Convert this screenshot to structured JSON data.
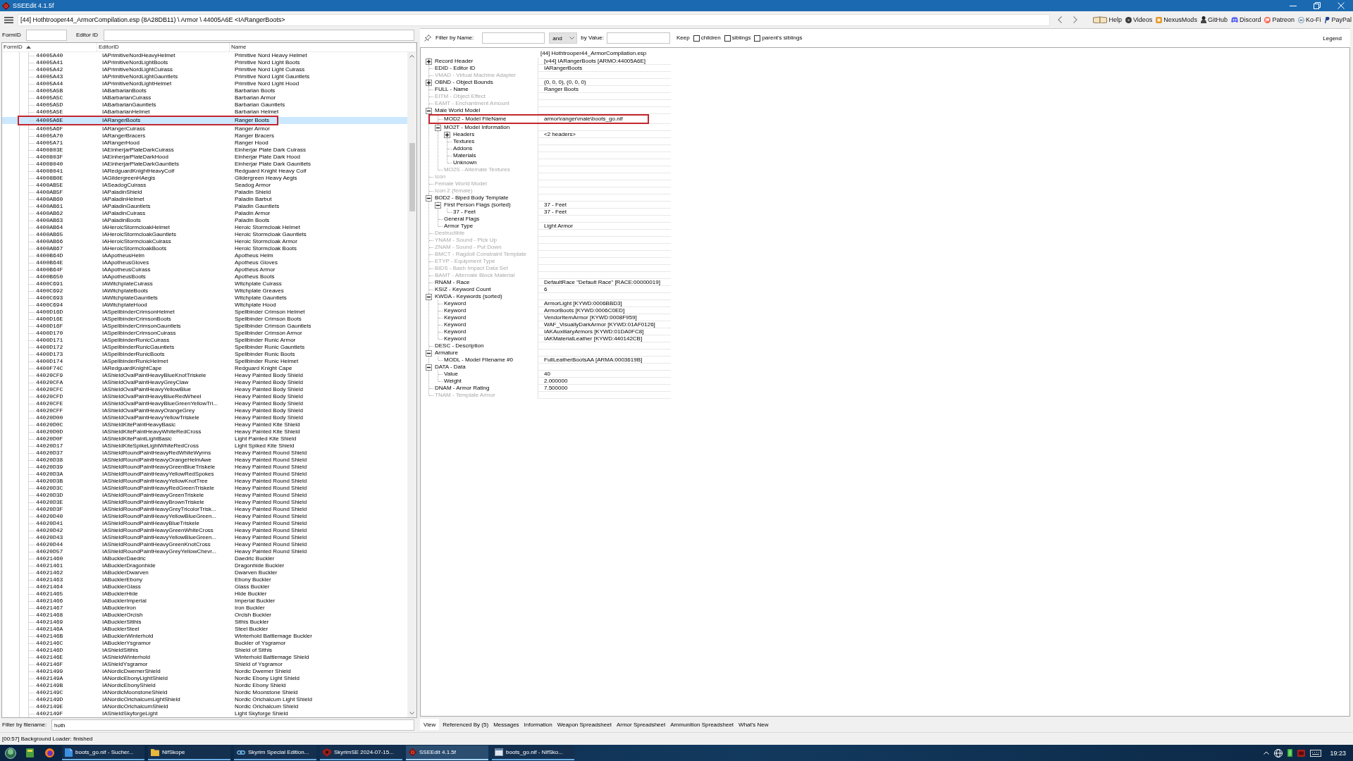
{
  "window": {
    "title": "SSEEdit 4.1.5f"
  },
  "path_bar": {
    "path": "[44] Hothtrooper44_ArmorCompilation.esp (8A28DB11) \\ Armor \\ 44005A6E <IARangerBoots>"
  },
  "toolbar_links": [
    "Help",
    "Videos",
    "NexusMods",
    "GitHub",
    "Discord",
    "Patreon",
    "Ko-Fi",
    "PayPal"
  ],
  "record_filter": {
    "formid_label": "FormID",
    "editorid_label": "Editor ID"
  },
  "record_list": {
    "columns": [
      {
        "label": "FormID",
        "sorted": true
      },
      {
        "label": "EditorID",
        "sorted": false
      },
      {
        "label": "Name",
        "sorted": false
      }
    ],
    "rows": [
      {
        "form_id": "44005A40",
        "editor_id": "IAPrimitiveNordHeavyHelmet",
        "name": "Primitive Nord Heavy Helmet",
        "selected": false,
        "marked": false
      },
      {
        "form_id": "44005A41",
        "editor_id": "IAPrimitiveNordLightBoots",
        "name": "Primitive Nord Light Boots",
        "selected": false,
        "marked": false
      },
      {
        "form_id": "44005A42",
        "editor_id": "IAPrimitiveNordLightCuirass",
        "name": "Primitive Nord Light Cuirass",
        "selected": false,
        "marked": false
      },
      {
        "form_id": "44005A43",
        "editor_id": "IAPrimitiveNordLightGauntlets",
        "name": "Primitive Nord Light Gauntlets",
        "selected": false,
        "marked": false
      },
      {
        "form_id": "44005A44",
        "editor_id": "IAPrimitiveNordLightHelmet",
        "name": "Primitive Nord Light Hood",
        "selected": false,
        "marked": false
      },
      {
        "form_id": "44005A5B",
        "editor_id": "IABarbarianBoots",
        "name": "Barbarian Boots",
        "selected": false,
        "marked": false
      },
      {
        "form_id": "44005A5C",
        "editor_id": "IABarbarianCuirass",
        "name": "Barbarian Armor",
        "selected": false,
        "marked": false
      },
      {
        "form_id": "44005A5D",
        "editor_id": "IABarbarianGauntlets",
        "name": "Barbarian Gauntlets",
        "selected": false,
        "marked": false
      },
      {
        "form_id": "44005A5E",
        "editor_id": "IABarbarianHelmet",
        "name": "Barbarian Helmet",
        "selected": false,
        "marked": false
      },
      {
        "form_id": "44005A6E",
        "editor_id": "IARangerBoots",
        "name": "Ranger Boots",
        "selected": true,
        "marked": true
      },
      {
        "form_id": "44005A6F",
        "editor_id": "IARangerCuirass",
        "name": "Ranger Armor",
        "selected": false,
        "marked": false
      },
      {
        "form_id": "44005A70",
        "editor_id": "IARangerBracers",
        "name": "Ranger Bracers",
        "selected": false,
        "marked": false
      },
      {
        "form_id": "44005A71",
        "editor_id": "IARangerHood",
        "name": "Ranger Hood",
        "selected": false,
        "marked": false
      },
      {
        "form_id": "4400803E",
        "editor_id": "IAEinherjarPlateDarkCuirass",
        "name": "Einherjar Plate Dark Cuirass",
        "selected": false,
        "marked": false
      },
      {
        "form_id": "4400803F",
        "editor_id": "IAEinherjarPlateDarkHood",
        "name": "Einherjar Plate Dark Hood",
        "selected": false,
        "marked": false
      },
      {
        "form_id": "44008040",
        "editor_id": "IAEinherjarPlateDarkGauntlets",
        "name": "Einherjar Plate Dark Gauntlets",
        "selected": false,
        "marked": false
      },
      {
        "form_id": "44008041",
        "editor_id": "IARedguardKnightHeavyCoif",
        "name": "Redguard Knight Heavy Coif",
        "selected": false,
        "marked": false
      },
      {
        "form_id": "44008B0E",
        "editor_id": "IAGildergreenHAegis",
        "name": "Gildergreen Heavy Aegis",
        "selected": false,
        "marked": false
      },
      {
        "form_id": "4400AB5E",
        "editor_id": "IASeadogCuirass",
        "name": "Seadog Armor",
        "selected": false,
        "marked": false
      },
      {
        "form_id": "4400AB5F",
        "editor_id": "IAPaladinShield",
        "name": "Paladin Shield",
        "selected": false,
        "marked": false
      },
      {
        "form_id": "4400AB60",
        "editor_id": "IAPaladinHelmet",
        "name": "Paladin Barbut",
        "selected": false,
        "marked": false
      },
      {
        "form_id": "4400AB61",
        "editor_id": "IAPaladinGauntlets",
        "name": "Paladin Gauntlets",
        "selected": false,
        "marked": false
      },
      {
        "form_id": "4400AB62",
        "editor_id": "IAPaladinCuirass",
        "name": "Paladin Armor",
        "selected": false,
        "marked": false
      },
      {
        "form_id": "4400AB63",
        "editor_id": "IAPaladinBoots",
        "name": "Paladin Boots",
        "selected": false,
        "marked": false
      },
      {
        "form_id": "4400AB64",
        "editor_id": "IAHeroicStormcloakHelmet",
        "name": "Heroic Stormcloak Helmet",
        "selected": false,
        "marked": false
      },
      {
        "form_id": "4400AB65",
        "editor_id": "IAHeroicStormcloakGauntlets",
        "name": "Heroic Stormcloak Gauntlets",
        "selected": false,
        "marked": false
      },
      {
        "form_id": "4400AB66",
        "editor_id": "IAHeroicStormcloakCuirass",
        "name": "Heroic Stormcloak Armor",
        "selected": false,
        "marked": false
      },
      {
        "form_id": "4400AB67",
        "editor_id": "IAHeroicStormcloakBoots",
        "name": "Heroic Stormcloak Boots",
        "selected": false,
        "marked": false
      },
      {
        "form_id": "4400B64D",
        "editor_id": "IAApotheusHelm",
        "name": "Apotheus Helm",
        "selected": false,
        "marked": false
      },
      {
        "form_id": "4400B64E",
        "editor_id": "IAApotheusGloves",
        "name": "Apotheus Gloves",
        "selected": false,
        "marked": false
      },
      {
        "form_id": "4400B64F",
        "editor_id": "IAApotheusCuirass",
        "name": "Apotheus Armor",
        "selected": false,
        "marked": false
      },
      {
        "form_id": "4400B650",
        "editor_id": "IAApotheusBoots",
        "name": "Apotheus Boots",
        "selected": false,
        "marked": false
      },
      {
        "form_id": "4400C691",
        "editor_id": "IAWitchplateCuirass",
        "name": "Witchplate Cuirass",
        "selected": false,
        "marked": false
      },
      {
        "form_id": "4400C692",
        "editor_id": "IAWitchplateBoots",
        "name": "Witchplate Greaves",
        "selected": false,
        "marked": false
      },
      {
        "form_id": "4400C693",
        "editor_id": "IAWitchplateGauntlets",
        "name": "Witchplate Gauntlets",
        "selected": false,
        "marked": false
      },
      {
        "form_id": "4400C694",
        "editor_id": "IAWitchplateHood",
        "name": "Witchplate Hood",
        "selected": false,
        "marked": false
      },
      {
        "form_id": "4400D16D",
        "editor_id": "IASpellbinderCrimsonHelmet",
        "name": "Spellbinder Crimson Helmet",
        "selected": false,
        "marked": false
      },
      {
        "form_id": "4400D16E",
        "editor_id": "IASpellbinderCrimsonBoots",
        "name": "Spellbinder Crimson Boots",
        "selected": false,
        "marked": false
      },
      {
        "form_id": "4400D16F",
        "editor_id": "IASpellbinderCrimsonGauntlets",
        "name": "Spellbinder Crimson Gauntlets",
        "selected": false,
        "marked": false
      },
      {
        "form_id": "4400D170",
        "editor_id": "IASpellbinderCrimsonCuirass",
        "name": "Spellbinder Crimson Armor",
        "selected": false,
        "marked": false
      },
      {
        "form_id": "4400D171",
        "editor_id": "IASpellbinderRunicCuirass",
        "name": "Spellbinder Runic Armor",
        "selected": false,
        "marked": false
      },
      {
        "form_id": "4400D172",
        "editor_id": "IASpellbinderRunicGauntlets",
        "name": "Spellbinder Runic Gauntlets",
        "selected": false,
        "marked": false
      },
      {
        "form_id": "4400D173",
        "editor_id": "IASpellbinderRunicBoots",
        "name": "Spellbinder Runic Boots",
        "selected": false,
        "marked": false
      },
      {
        "form_id": "4400D174",
        "editor_id": "IASpellbinderRunicHelmet",
        "name": "Spellbinder Runic Helmet",
        "selected": false,
        "marked": false
      },
      {
        "form_id": "4400F74C",
        "editor_id": "IARedguardKnightCape",
        "name": "Redguard Knight Cape",
        "selected": false,
        "marked": false
      },
      {
        "form_id": "44020CF9",
        "editor_id": "IAShieldOvalPaintHeavyBlueKnotTriskele",
        "name": "Heavy Painted Body Shield",
        "selected": false,
        "marked": false
      },
      {
        "form_id": "44020CFA",
        "editor_id": "IAShieldOvalPaintHeavyGreyClaw",
        "name": "Heavy Painted Body Shield",
        "selected": false,
        "marked": false
      },
      {
        "form_id": "44020CFC",
        "editor_id": "IAShieldOvalPaintHeavyYellowBlue",
        "name": "Heavy Painted Body Shield",
        "selected": false,
        "marked": false
      },
      {
        "form_id": "44020CFD",
        "editor_id": "IAShieldOvalPaintHeavyBlueRedWheel",
        "name": "Heavy Painted Body Shield",
        "selected": false,
        "marked": false
      },
      {
        "form_id": "44020CFE",
        "editor_id": "IAShieldOvalPaintHeavyBlueGreenYellowTri...",
        "name": "Heavy Painted Body Shield",
        "selected": false,
        "marked": false
      },
      {
        "form_id": "44020CFF",
        "editor_id": "IAShieldOvalPaintHeavyOrangeGrey",
        "name": "Heavy Painted Body Shield",
        "selected": false,
        "marked": false
      },
      {
        "form_id": "44020D00",
        "editor_id": "IAShieldOvalPaintHeavyYellowTriskele",
        "name": "Heavy Painted Body Shield",
        "selected": false,
        "marked": false
      },
      {
        "form_id": "44020D0C",
        "editor_id": "IAShieldKitePaintHeavyBasic",
        "name": "Heavy Painted Kite Shield",
        "selected": false,
        "marked": false
      },
      {
        "form_id": "44020D0D",
        "editor_id": "IAShieldKitePaintHeavyWhiteRedCross",
        "name": "Heavy Painted Kite Shield",
        "selected": false,
        "marked": false
      },
      {
        "form_id": "44020D0F",
        "editor_id": "IAShieldKitePaintLightBasic",
        "name": "Light Painted Kite Shield",
        "selected": false,
        "marked": false
      },
      {
        "form_id": "44020D17",
        "editor_id": "IAShieldKiteSpikeLightWhiteRedCross",
        "name": "Light Spiked Kite Shield",
        "selected": false,
        "marked": false
      },
      {
        "form_id": "44020D37",
        "editor_id": "IAShieldRoundPaintHeavyRedWhiteWyrms",
        "name": "Heavy Painted Round Shield",
        "selected": false,
        "marked": false
      },
      {
        "form_id": "44020D38",
        "editor_id": "IAShieldRoundPaintHeavyOrangeHelmAwe",
        "name": "Heavy Painted Round Shield",
        "selected": false,
        "marked": false
      },
      {
        "form_id": "44020D39",
        "editor_id": "IAShieldRoundPaintHeavyGreenBlueTriskele",
        "name": "Heavy Painted Round Shield",
        "selected": false,
        "marked": false
      },
      {
        "form_id": "44020D3A",
        "editor_id": "IAShieldRoundPaintHeavyYellowRedSpokes",
        "name": "Heavy Painted Round Shield",
        "selected": false,
        "marked": false
      },
      {
        "form_id": "44020D3B",
        "editor_id": "IAShieldRoundPaintHeavyYellowKnotTree",
        "name": "Heavy Painted Round Shield",
        "selected": false,
        "marked": false
      },
      {
        "form_id": "44020D3C",
        "editor_id": "IAShieldRoundPaintHeavyRedGreenTriskele",
        "name": "Heavy Painted Round Shield",
        "selected": false,
        "marked": false
      },
      {
        "form_id": "44020D3D",
        "editor_id": "IAShieldRoundPaintHeavyGreenTriskele",
        "name": "Heavy Painted Round Shield",
        "selected": false,
        "marked": false
      },
      {
        "form_id": "44020D3E",
        "editor_id": "IAShieldRoundPaintHeavyBrownTriskele",
        "name": "Heavy Painted Round Shield",
        "selected": false,
        "marked": false
      },
      {
        "form_id": "44020D3F",
        "editor_id": "IAShieldRoundPaintHeavyGreyTricolorTrisk...",
        "name": "Heavy Painted Round Shield",
        "selected": false,
        "marked": false
      },
      {
        "form_id": "44020D40",
        "editor_id": "IAShieldRoundPaintHeavyYellowBlueGreen...",
        "name": "Heavy Painted Round Shield",
        "selected": false,
        "marked": false
      },
      {
        "form_id": "44020D41",
        "editor_id": "IAShieldRoundPaintHeavyBlueTriskele",
        "name": "Heavy Painted Round Shield",
        "selected": false,
        "marked": false
      },
      {
        "form_id": "44020D42",
        "editor_id": "IAShieldRoundPaintHeavyGreenWhiteCross",
        "name": "Heavy Painted Round Shield",
        "selected": false,
        "marked": false
      },
      {
        "form_id": "44020D43",
        "editor_id": "IAShieldRoundPaintHeavyYellowBlueGreen...",
        "name": "Heavy Painted Round Shield",
        "selected": false,
        "marked": false
      },
      {
        "form_id": "44020D44",
        "editor_id": "IAShieldRoundPaintHeavyGreenKnotCross",
        "name": "Heavy Painted Round Shield",
        "selected": false,
        "marked": false
      },
      {
        "form_id": "44020D57",
        "editor_id": "IAShieldRoundPaintHeavyGreyYellowChevr...",
        "name": "Heavy Painted Round Shield",
        "selected": false,
        "marked": false
      },
      {
        "form_id": "44021460",
        "editor_id": "IABucklerDaedric",
        "name": "Daedric Buckler",
        "selected": false,
        "marked": false
      },
      {
        "form_id": "44021461",
        "editor_id": "IABucklerDragonhide",
        "name": "Dragonhide Buckler",
        "selected": false,
        "marked": false
      },
      {
        "form_id": "44021462",
        "editor_id": "IABucklerDwarven",
        "name": "Dwarven Buckler",
        "selected": false,
        "marked": false
      },
      {
        "form_id": "44021463",
        "editor_id": "IABucklerEbony",
        "name": "Ebony Buckler",
        "selected": false,
        "marked": false
      },
      {
        "form_id": "44021464",
        "editor_id": "IABucklerGlass",
        "name": "Glass Buckler",
        "selected": false,
        "marked": false
      },
      {
        "form_id": "44021465",
        "editor_id": "IABucklerHide",
        "name": "Hide Buckler",
        "selected": false,
        "marked": false
      },
      {
        "form_id": "44021466",
        "editor_id": "IABucklerImperial",
        "name": "Imperial Buckler",
        "selected": false,
        "marked": false
      },
      {
        "form_id": "44021467",
        "editor_id": "IABucklerIron",
        "name": "Iron Buckler",
        "selected": false,
        "marked": false
      },
      {
        "form_id": "44021468",
        "editor_id": "IABucklerOrcish",
        "name": "Orcish Buckler",
        "selected": false,
        "marked": false
      },
      {
        "form_id": "44021469",
        "editor_id": "IABucklerSitihis",
        "name": "Sithis Buckler",
        "selected": false,
        "marked": false
      },
      {
        "form_id": "4402146A",
        "editor_id": "IABucklerSteel",
        "name": "Steel Buckler",
        "selected": false,
        "marked": false
      },
      {
        "form_id": "4402146B",
        "editor_id": "IABucklerWinterhold",
        "name": "Winterhold Battlemage Buckler",
        "selected": false,
        "marked": false
      },
      {
        "form_id": "4402146C",
        "editor_id": "IABucklerYsgramor",
        "name": "Buckler of Ysgramor",
        "selected": false,
        "marked": false
      },
      {
        "form_id": "4402146D",
        "editor_id": "IAShieldSitihis",
        "name": "Shield of Sithis",
        "selected": false,
        "marked": false
      },
      {
        "form_id": "4402146E",
        "editor_id": "IAShieldWinterhold",
        "name": "Winterhold Battlemage Shield",
        "selected": false,
        "marked": false
      },
      {
        "form_id": "4402146F",
        "editor_id": "IAShieldYsgramor",
        "name": "Shield of Ysgramor",
        "selected": false,
        "marked": false
      },
      {
        "form_id": "44021499",
        "editor_id": "IANordicDwemerShield",
        "name": "Nordic Dwemer Shield",
        "selected": false,
        "marked": false
      },
      {
        "form_id": "4402149A",
        "editor_id": "IANordicEbonyLightShield",
        "name": "Nordic Ebony Light Shield",
        "selected": false,
        "marked": false
      },
      {
        "form_id": "4402149B",
        "editor_id": "IANordicEbonyShield",
        "name": "Nordic Ebony Shield",
        "selected": false,
        "marked": false
      },
      {
        "form_id": "4402149C",
        "editor_id": "IANordicMoonstoneShield",
        "name": "Nordic Moonstone Shield",
        "selected": false,
        "marked": false
      },
      {
        "form_id": "4402149D",
        "editor_id": "IANordicOrichalcumLightShield",
        "name": "Nordic Orichalcum Light Shield",
        "selected": false,
        "marked": false
      },
      {
        "form_id": "4402149E",
        "editor_id": "IANordicOrichalcumShield",
        "name": "Nordic Orichalcum Shield",
        "selected": false,
        "marked": false
      },
      {
        "form_id": "4402149F",
        "editor_id": "IAShieldSkyforgeLight",
        "name": "Light Skyforge Shield",
        "selected": false,
        "marked": false
      }
    ]
  },
  "file_filter": {
    "label": "Filter by filename:",
    "value": "hoth"
  },
  "view_filter": {
    "name_label": "Filter by Name:",
    "operator": "and",
    "value_label": "by Value:",
    "keep_label": "Keep",
    "keep_options": [
      {
        "label": "children",
        "checked": false
      },
      {
        "label": "siblings",
        "checked": false
      },
      {
        "label": "parent's siblings",
        "checked": false
      }
    ],
    "legend": "Legend"
  },
  "record_view": {
    "file_header": "[44] Hothtrooper44_ArmorCompilation.esp",
    "nodes": [
      {
        "label": "Record Header",
        "value": "[v44] IARangerBoots [ARMO:44005A6E]",
        "expanded": false,
        "disabled": false,
        "marked": false
      },
      {
        "label": "EDID - Editor ID",
        "value": "IARangerBoots",
        "disabled": false,
        "marked": false
      },
      {
        "label": "VMAD - Virtual Machine Adapter",
        "disabled": true,
        "marked": false
      },
      {
        "label": "OBND - Object Bounds",
        "value": "(0, 0, 0), (0, 0, 0)",
        "expanded": false,
        "disabled": false,
        "marked": false
      },
      {
        "label": "FULL - Name",
        "value": "Ranger Boots",
        "disabled": false,
        "marked": false
      },
      {
        "label": "EITM - Object Effect",
        "disabled": true,
        "marked": false
      },
      {
        "label": "EAMT - Enchantment Amount",
        "disabled": true,
        "marked": false
      },
      {
        "label": "Male World Model",
        "expanded": true,
        "disabled": false,
        "marked": false,
        "children": [
          {
            "label": "MOD2 - Model FileName",
            "value": "armor\\ranger\\male\\boots_go.nif",
            "disabled": false,
            "marked": true
          },
          {
            "label": "MO2T - Model Information",
            "expanded": true,
            "disabled": false,
            "marked": false,
            "children": [
              {
                "label": "Headers",
                "value": "<2 headers>",
                "expanded": false,
                "disabled": false,
                "marked": false
              },
              {
                "label": "Textures",
                "disabled": false,
                "marked": false
              },
              {
                "label": "Addons",
                "disabled": false,
                "marked": false
              },
              {
                "label": "Materials",
                "disabled": false,
                "marked": false
              },
              {
                "label": "Unknown",
                "disabled": false,
                "marked": false
              }
            ]
          },
          {
            "label": "MO2S - Alternate Textures",
            "disabled": true,
            "marked": false
          }
        ]
      },
      {
        "label": "Icon",
        "disabled": true,
        "marked": false
      },
      {
        "label": "Female World Model",
        "disabled": true,
        "marked": false
      },
      {
        "label": "Icon 2 (female)",
        "disabled": true,
        "marked": false
      },
      {
        "label": "BOD2 - Biped Body Template",
        "expanded": true,
        "disabled": false,
        "marked": false,
        "children": [
          {
            "label": "First Person Flags (sorted)",
            "value": "37 - Feet",
            "expanded": true,
            "disabled": false,
            "marked": false,
            "children": [
              {
                "label": "37 - Feet",
                "value": "37 - Feet",
                "disabled": false,
                "marked": false
              }
            ]
          },
          {
            "label": "General Flags",
            "disabled": false,
            "marked": false
          },
          {
            "label": "Armor Type",
            "value": "Light Armor",
            "disabled": false,
            "marked": false
          }
        ]
      },
      {
        "label": "Destructible",
        "disabled": true,
        "marked": false
      },
      {
        "label": "YNAM - Sound - Pick Up",
        "disabled": true,
        "marked": false
      },
      {
        "label": "ZNAM - Sound - Put Down",
        "disabled": true,
        "marked": false
      },
      {
        "label": "BMCT - Ragdoll Constraint Template",
        "disabled": true,
        "marked": false
      },
      {
        "label": "ETYP - Equipment Type",
        "disabled": true,
        "marked": false
      },
      {
        "label": "BIDS - Bash Impact Data Set",
        "disabled": true,
        "marked": false
      },
      {
        "label": "BAMT - Alternate Block Material",
        "disabled": true,
        "marked": false
      },
      {
        "label": "RNAM - Race",
        "value": "DefaultRace \"Default Race\" [RACE:00000019]",
        "disabled": false,
        "marked": false
      },
      {
        "label": "KSIZ - Keyword Count",
        "value": "6",
        "disabled": false,
        "marked": false
      },
      {
        "label": "KWDA - Keywords (sorted)",
        "expanded": true,
        "disabled": false,
        "marked": false,
        "children": [
          {
            "label": "Keyword",
            "value": "ArmorLight [KYWD:0006BBD3]",
            "disabled": false,
            "marked": false
          },
          {
            "label": "Keyword",
            "value": "ArmorBoots [KYWD:0006C0ED]",
            "disabled": false,
            "marked": false
          },
          {
            "label": "Keyword",
            "value": "VendorItemArmor [KYWD:0008F959]",
            "disabled": false,
            "marked": false
          },
          {
            "label": "Keyword",
            "value": "WAF_VisuallyDarkArmor [KYWD:01AF0126]",
            "disabled": false,
            "marked": false
          },
          {
            "label": "Keyword",
            "value": "IAKAuxiliaryArmors [KYWD:01DA0FC8]",
            "disabled": false,
            "marked": false
          },
          {
            "label": "Keyword",
            "value": "IAKMaterialLeather [KYWD:440142CB]",
            "disabled": false,
            "marked": false
          }
        ]
      },
      {
        "label": "DESC - Description",
        "disabled": false,
        "marked": false
      },
      {
        "label": "Armature",
        "expanded": true,
        "disabled": false,
        "marked": false,
        "children": [
          {
            "label": "MODL - Model Filename #0",
            "value": "FullLeatherBootsAA [ARMA:0003619B]",
            "disabled": false,
            "marked": false
          }
        ]
      },
      {
        "label": "DATA - Data",
        "expanded": true,
        "disabled": false,
        "marked": false,
        "children": [
          {
            "label": "Value",
            "value": "40",
            "disabled": false,
            "marked": false
          },
          {
            "label": "Weight",
            "value": "2.000000",
            "disabled": false,
            "marked": false
          }
        ]
      },
      {
        "label": "DNAM - Armor Rating",
        "value": "7.500000",
        "disabled": false,
        "marked": false
      },
      {
        "label": "TNAM - Template Armor",
        "disabled": true,
        "marked": false
      }
    ]
  },
  "tabs": [
    {
      "label": "View",
      "selected": true
    },
    {
      "label": "Referenced By (5)",
      "selected": false
    },
    {
      "label": "Messages",
      "selected": false
    },
    {
      "label": "Information",
      "selected": false
    },
    {
      "label": "Weapon Spreadsheet",
      "selected": false
    },
    {
      "label": "Armor Spreadsheet",
      "selected": false
    },
    {
      "label": "Ammunition Spreadsheet",
      "selected": false
    },
    {
      "label": "What's New",
      "selected": false
    }
  ],
  "status_bar": "[00:57] Background Loader: finished",
  "taskbar": {
    "apps": [
      {
        "label": "boots_go.nif - Sucher...",
        "selected": false
      },
      {
        "label": "NifSkope",
        "selected": false
      },
      {
        "label": "Skyrim Special Edition...",
        "selected": false
      },
      {
        "label": "SkyrimSE 2024-07-15...",
        "selected": false
      },
      {
        "label": "SSEEdit 4.1.5f",
        "selected": true
      },
      {
        "label": "boots_go.nif - NifSko...",
        "selected": false
      }
    ],
    "clock": "19:23"
  }
}
